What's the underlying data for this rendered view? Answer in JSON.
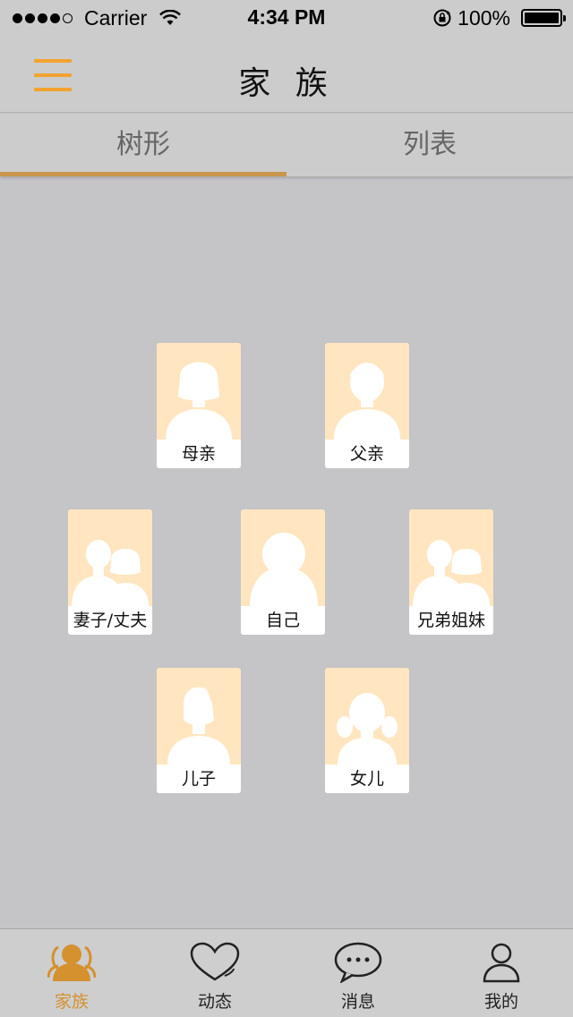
{
  "status_bar": {
    "carrier": "Carrier",
    "time": "4:34 PM",
    "battery": "100%"
  },
  "nav": {
    "title": "家 族",
    "menu_icon": "hamburger-menu-icon"
  },
  "tabs": [
    {
      "label": "树形",
      "active": true
    },
    {
      "label": "列表",
      "active": false
    }
  ],
  "family": {
    "mother": "母亲",
    "father": "父亲",
    "spouse": "妻子/丈夫",
    "self": "自己",
    "siblings": "兄弟姐妹",
    "son": "儿子",
    "daughter": "女儿"
  },
  "tabbar": [
    {
      "label": "家族",
      "icon": "family-icon",
      "active": true
    },
    {
      "label": "动态",
      "icon": "heart-icon",
      "active": false
    },
    {
      "label": "消息",
      "icon": "chat-bubble-icon",
      "active": false
    },
    {
      "label": "我的",
      "icon": "person-icon",
      "active": false
    }
  ],
  "colors": {
    "accent": "#f2a32f",
    "tab_indicator": "#c9964b",
    "card_bg": "#ffe6c0",
    "background": "#c5c4c7",
    "bar_bg": "#cccccc"
  }
}
